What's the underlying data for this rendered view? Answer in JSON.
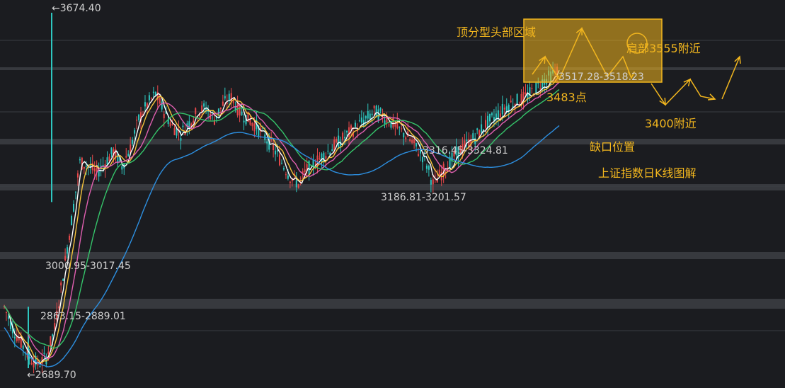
{
  "chart_data": {
    "type": "candlestick",
    "title": "上证指数日K线图解",
    "price_labels": {
      "high": "←3674.40",
      "low": "←2689.70",
      "band_3000": "3000.95-3017.45",
      "band_2863": "2863.15-2889.01",
      "band_3186": "3186.81-3201.57",
      "band_3316": "3316.45-3324.81",
      "band_3517": "3517.28-3518.23"
    },
    "annotations": {
      "top_zone": "顶分型头部区域",
      "shoulder": "肩部3555附近",
      "point_3483": "3483点",
      "near_3400": "3400附近",
      "gap": "缺口位置"
    },
    "support_resistance_levels": [
      3555,
      3517.28,
      3400,
      3324.81,
      3316.45,
      3201.57,
      3186.81,
      3017.45,
      3000.95,
      2889.01,
      2863.15
    ],
    "ylim": [
      2680,
      3690
    ],
    "extremes": {
      "high": 3674.4,
      "low": 2689.7
    },
    "close_series_approx": [
      2860,
      2800,
      2760,
      2720,
      2700,
      2720,
      2800,
      2950,
      3100,
      3260,
      3250,
      3230,
      3260,
      3290,
      3250,
      3300,
      3380,
      3420,
      3450,
      3400,
      3360,
      3340,
      3370,
      3400,
      3410,
      3380,
      3420,
      3440,
      3400,
      3380,
      3360,
      3330,
      3300,
      3260,
      3220,
      3200,
      3240,
      3260,
      3280,
      3300,
      3320,
      3340,
      3360,
      3380,
      3400,
      3390,
      3370,
      3350,
      3330,
      3300,
      3270,
      3200,
      3230,
      3260,
      3290,
      3310,
      3330,
      3360,
      3380,
      3400,
      3420,
      3430,
      3440,
      3460,
      3483,
      3500,
      3517
    ],
    "moving_averages": [
      {
        "color": "#ffffff"
      },
      {
        "color": "#f5c33b"
      },
      {
        "color": "#e05fb0"
      },
      {
        "color": "#35c46a"
      },
      {
        "color": "#2d8fe0"
      }
    ],
    "colors": {
      "up": "#e8484a",
      "down": "#2ec7c0",
      "annotation": "#f2b61e",
      "zone_fill": "rgba(242,182,30,0.55)",
      "grid": "#3a3c42",
      "band": "#3c3e44"
    }
  }
}
